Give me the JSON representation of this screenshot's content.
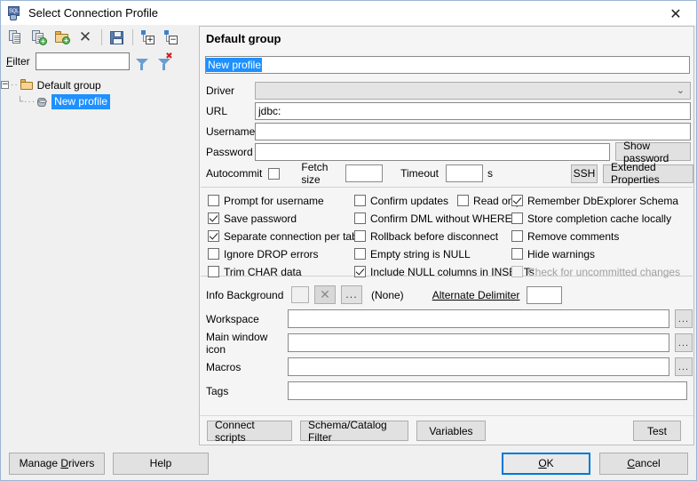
{
  "window": {
    "title": "Select Connection Profile",
    "title_icon": "sql-database-icon",
    "close_label": "✕"
  },
  "toolbar": {
    "buttons": [
      {
        "name": "copy-profile-button",
        "icon": "copy-profile-icon",
        "tooltip": "Copy profile"
      },
      {
        "name": "new-profile-button",
        "icon": "new-profile-icon",
        "tooltip": "New profile"
      },
      {
        "name": "new-group-button",
        "icon": "new-folder-icon",
        "tooltip": "New group"
      },
      {
        "name": "delete-profile-button",
        "icon": "delete-x-icon",
        "tooltip": "Delete"
      },
      {
        "name": "save-profiles-button",
        "icon": "save-disk-icon",
        "tooltip": "Save"
      },
      {
        "name": "expand-all-button",
        "icon": "tree-expand-icon",
        "tooltip": "Expand all"
      },
      {
        "name": "collapse-all-button",
        "icon": "tree-collapse-icon",
        "tooltip": "Collapse all"
      }
    ]
  },
  "filter": {
    "label": "Filter",
    "label_mnemonic": "F",
    "value": "",
    "placeholder": "",
    "apply_icon": "funnel-icon",
    "clear_icon": "funnel-clear-icon"
  },
  "tree": {
    "group": {
      "label": "Default group",
      "expanded": true,
      "expander": "−",
      "icon": "folder-icon"
    },
    "child": {
      "label": "New profile",
      "selected": true,
      "icon": "database-icon"
    }
  },
  "profile": {
    "group_title": "Default group",
    "name_value": "New profile",
    "name_selected": true,
    "driver": {
      "label": "Driver",
      "value": "",
      "chevron": "⌄",
      "disabled": true
    },
    "url": {
      "label": "URL",
      "value": "jdbc:"
    },
    "username": {
      "label": "Username",
      "value": ""
    },
    "password": {
      "label": "Password",
      "value": ""
    },
    "show_password_button": "Show password",
    "autocommit": {
      "label": "Autocommit",
      "checked": false
    },
    "fetch_size": {
      "label": "Fetch size",
      "value": ""
    },
    "timeout": {
      "label": "Timeout",
      "value": "",
      "unit": "s"
    },
    "ssh_button": "SSH",
    "extended_properties_button": "Extended Properties"
  },
  "options": {
    "column1": [
      {
        "label": "Prompt for username",
        "checked": false,
        "disabled": false
      },
      {
        "label": "Save password",
        "checked": true,
        "disabled": false
      },
      {
        "label": "Separate connection per tab",
        "checked": true,
        "disabled": false
      },
      {
        "label": "Ignore DROP errors",
        "checked": false,
        "disabled": false
      },
      {
        "label": "Trim CHAR data",
        "checked": false,
        "disabled": false
      }
    ],
    "column2": [
      {
        "label": "Confirm updates",
        "checked": false,
        "disabled": false
      },
      {
        "label": "Confirm DML without WHERE",
        "checked": false,
        "disabled": false
      },
      {
        "label": "Rollback before disconnect",
        "checked": false,
        "disabled": false
      },
      {
        "label": "Empty string is NULL",
        "checked": false,
        "disabled": false
      },
      {
        "label": "Include NULL columns in INSERTs",
        "checked": true,
        "disabled": false
      }
    ],
    "column2b": [
      {
        "label": "Read only",
        "checked": false,
        "disabled": false
      }
    ],
    "column3": [
      {
        "label": "Remember DbExplorer Schema",
        "checked": true,
        "disabled": false
      },
      {
        "label": "Store completion cache locally",
        "checked": false,
        "disabled": false
      },
      {
        "label": "Remove comments",
        "checked": false,
        "disabled": false
      },
      {
        "label": "Hide warnings",
        "checked": false,
        "disabled": false
      },
      {
        "label": "Check for uncommitted changes",
        "checked": false,
        "disabled": true
      }
    ]
  },
  "appearance": {
    "info_background_label": "Info Background",
    "color_swatch_value": "",
    "clear_color_icon": "✕",
    "pick_color_label": "...",
    "none_text": "(None)",
    "alternate_delimiter_label": "Alternate Delimiter",
    "alternate_delimiter_value": ""
  },
  "paths": [
    {
      "label": "Workspace",
      "value": "",
      "browse_label": "...",
      "name": "workspace"
    },
    {
      "label": "Main window icon",
      "value": "",
      "browse_label": "...",
      "name": "main-window-icon"
    },
    {
      "label": "Macros",
      "value": "",
      "browse_label": "...",
      "name": "macros"
    }
  ],
  "tags": {
    "label": "Tags",
    "value": ""
  },
  "panel_buttons": {
    "connect_scripts": "Connect scripts",
    "schema_catalog_filter": "Schema/Catalog Filter",
    "variables": "Variables",
    "test": "Test"
  },
  "footer": {
    "manage_drivers": "Manage Drivers",
    "manage_drivers_mnemonic": "D",
    "help": "Help",
    "ok": "OK",
    "ok_mnemonic": "O",
    "cancel": "Cancel",
    "cancel_mnemonic": "C"
  },
  "colors": {
    "selection_blue": "#1e90ff",
    "default_button_border": "#0078d7",
    "window_border": "#9ab6d4",
    "panel_bg": "#f5f5f5"
  }
}
